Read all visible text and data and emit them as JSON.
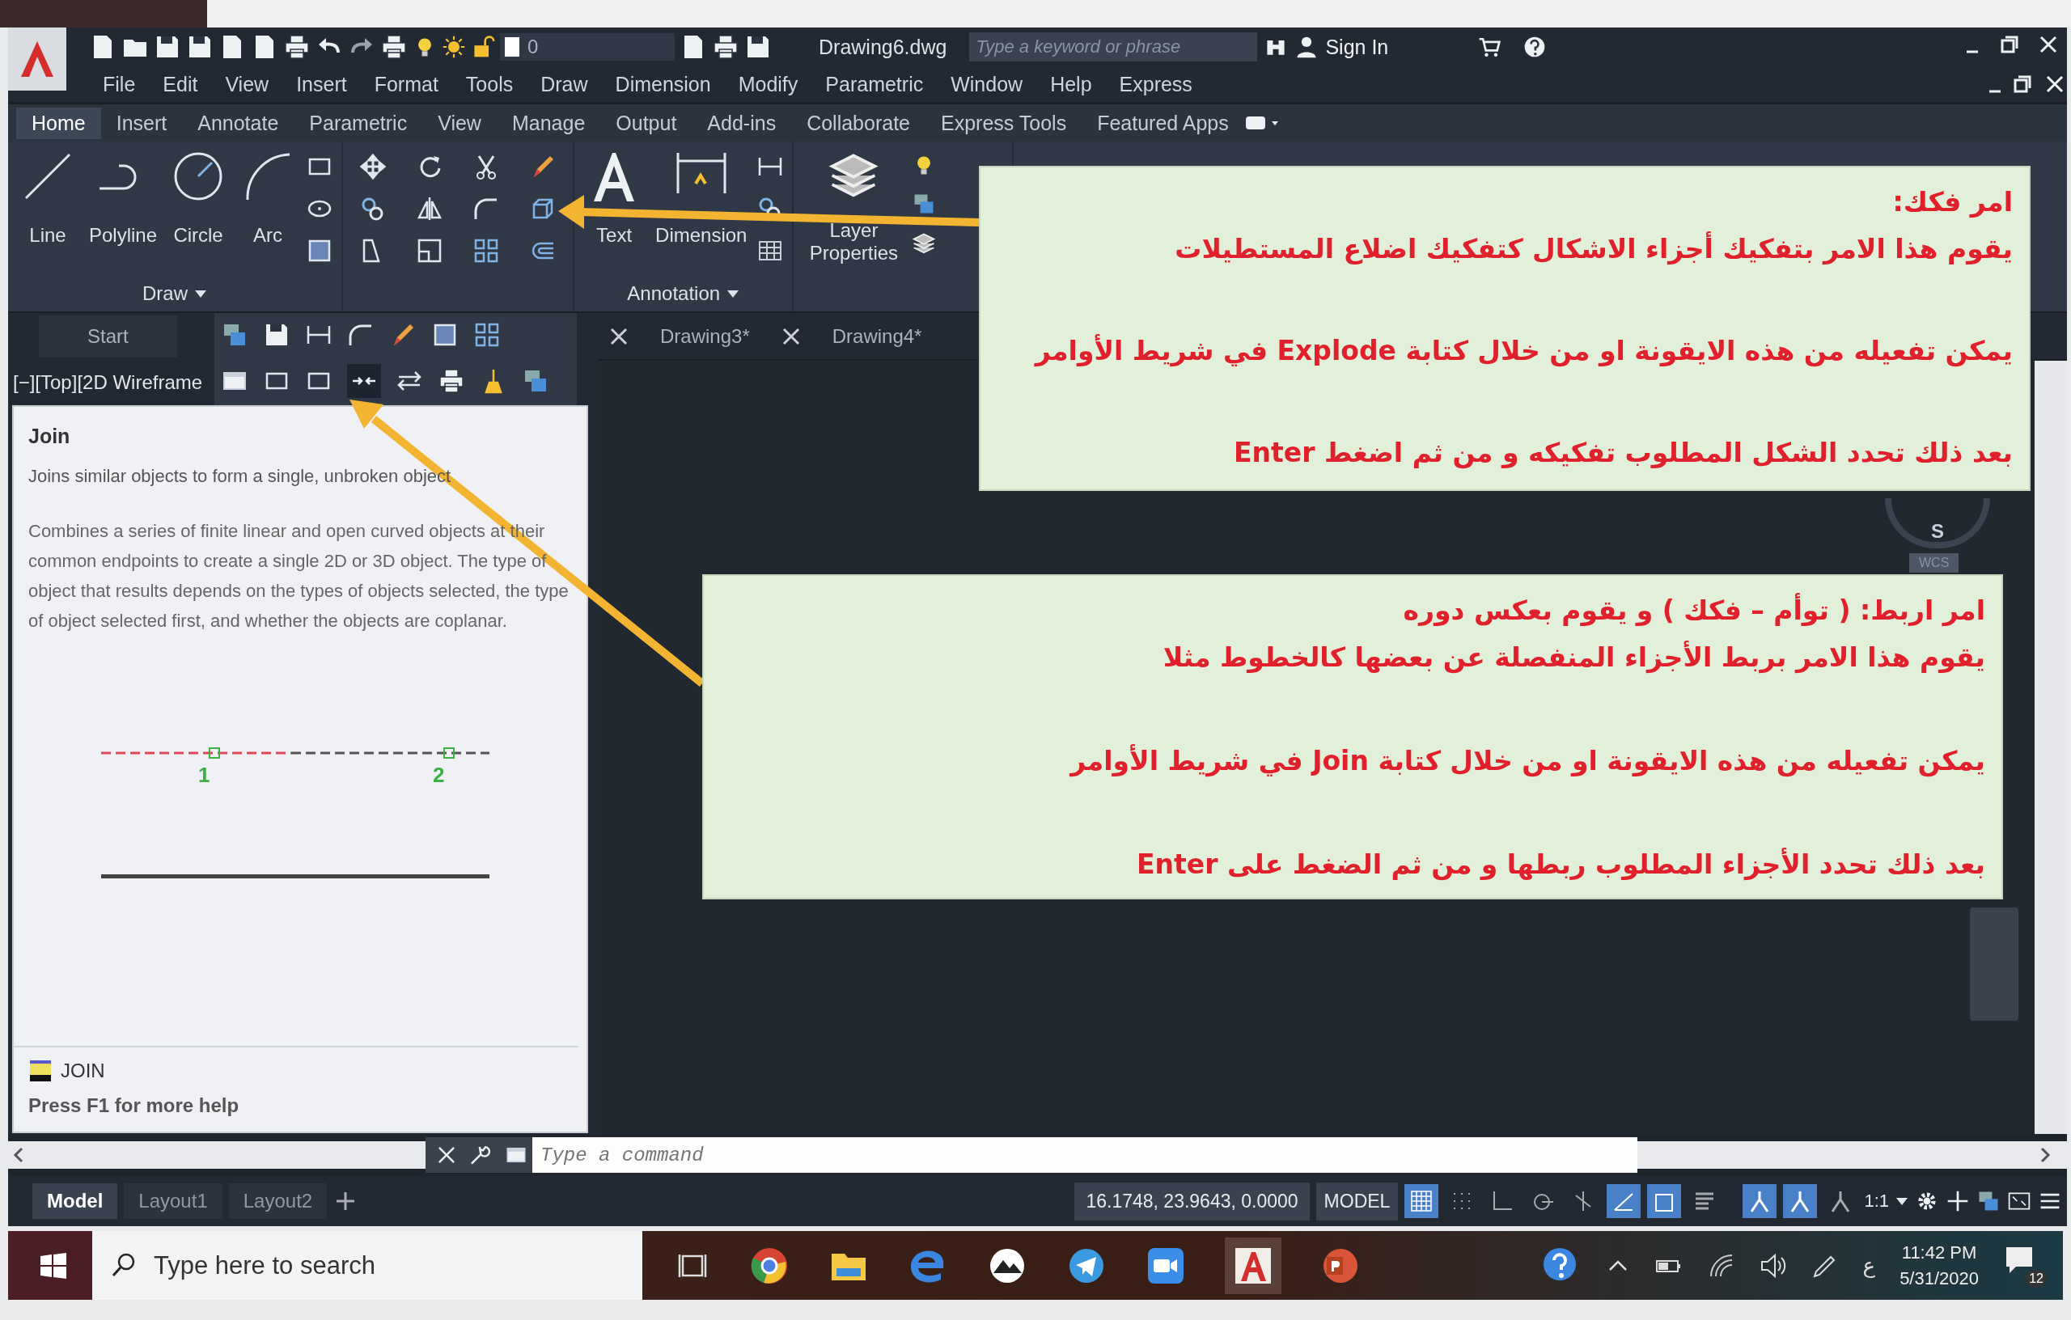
{
  "title_bar": {
    "layer": "0",
    "document": "Drawing6.dwg",
    "search": {
      "placeholder": "Type a keyword or phrase"
    },
    "sign_in": "Sign In"
  },
  "menu_bar": [
    "File",
    "Edit",
    "View",
    "Insert",
    "Format",
    "Tools",
    "Draw",
    "Dimension",
    "Modify",
    "Parametric",
    "Window",
    "Help",
    "Express"
  ],
  "ribbon_tabs": [
    {
      "label": "Home",
      "selected": true
    },
    {
      "label": "Insert",
      "selected": false
    },
    {
      "label": "Annotate",
      "selected": false
    },
    {
      "label": "Parametric",
      "selected": false
    },
    {
      "label": "View",
      "selected": false
    },
    {
      "label": "Manage",
      "selected": false
    },
    {
      "label": "Output",
      "selected": false
    },
    {
      "label": "Add-ins",
      "selected": false
    },
    {
      "label": "Collaborate",
      "selected": false
    },
    {
      "label": "Express Tools",
      "selected": false
    },
    {
      "label": "Featured Apps",
      "selected": false
    }
  ],
  "ribbon": {
    "draw_tools": [
      "Line",
      "Polyline",
      "Circle",
      "Arc"
    ],
    "draw_title": "Draw",
    "annotation_tools": [
      "Text",
      "Dimension"
    ],
    "annotation_title": "Annotation",
    "layer_tool": "Layer Properties"
  },
  "file_tabs": [
    {
      "label": "Start",
      "selected": false
    },
    {
      "label": "Drawing3*",
      "selected": false
    },
    {
      "label": "Drawing4*",
      "selected": false
    }
  ],
  "viewport_label": "[−][Top][2D Wireframe",
  "tooltip": {
    "title": "Join",
    "summary": "Joins similar objects to form a single, unbroken object",
    "description": "Combines a series of finite linear and open curved objects at their common endpoints to create a single 2D or 3D object. The type of object that results depends on the types of objects selected, the type of object selected first, and whether the objects are coplanar.",
    "markers": [
      "1",
      "2"
    ],
    "command": "JOIN",
    "help": "Press F1 for more help"
  },
  "viewcube": {
    "direction": "S",
    "ucs": "WCS"
  },
  "callouts": [
    {
      "heading": "امر فكك:",
      "lines": [
        "يقوم هذا الامر بتفكيك أجزاء الاشكال كتفكيك اضلاع المستطيلات",
        "يمكن تفعيله من هذه الايقونة او من خلال كتابة  Explode في شريط الأوامر",
        "بعد ذلك تحدد الشكل المطلوب تفكيكه و من ثم اضغط  Enter"
      ]
    },
    {
      "heading": "امر اربط: ( توأم – فكك ) و يقوم بعكس دوره",
      "lines": [
        "يقوم هذا الامر بربط الأجزاء المنفصلة عن بعضها كالخطوط مثلا",
        "يمكن تفعيله من هذه الايقونة او من خلال كتابة  Join في شريط الأوامر",
        "بعد ذلك تحدد الأجزاء المطلوب ربطها و من ثم الضغط على  Enter"
      ]
    }
  ],
  "command_line": {
    "placeholder": "Type a command"
  },
  "layout_tabs": [
    {
      "label": "Model",
      "selected": true
    },
    {
      "label": "Layout1",
      "selected": false
    },
    {
      "label": "Layout2",
      "selected": false
    }
  ],
  "status_bar": {
    "coordinates": "16.1748, 23.9643, 0.0000",
    "space": "MODEL",
    "scale": "1:1",
    "toggles": [
      {
        "kind": "grid",
        "on": true
      },
      {
        "kind": "snap",
        "on": false
      },
      {
        "kind": "ortho",
        "on": false
      },
      {
        "kind": "polar",
        "on": false
      },
      {
        "kind": "osnap",
        "on": false
      },
      {
        "kind": "dynucs",
        "on": true
      },
      {
        "kind": "frame",
        "on": true
      },
      {
        "kind": "lineweight",
        "on": false
      },
      {
        "kind": "annoscale",
        "on": true
      },
      {
        "kind": "annoauto",
        "on": true
      },
      {
        "kind": "annovis",
        "on": false
      }
    ]
  },
  "taskbar": {
    "search": {
      "placeholder": "Type here to search"
    },
    "language": "ع",
    "time": "11:42 PM",
    "date": "5/31/2020",
    "notifications": "12"
  }
}
